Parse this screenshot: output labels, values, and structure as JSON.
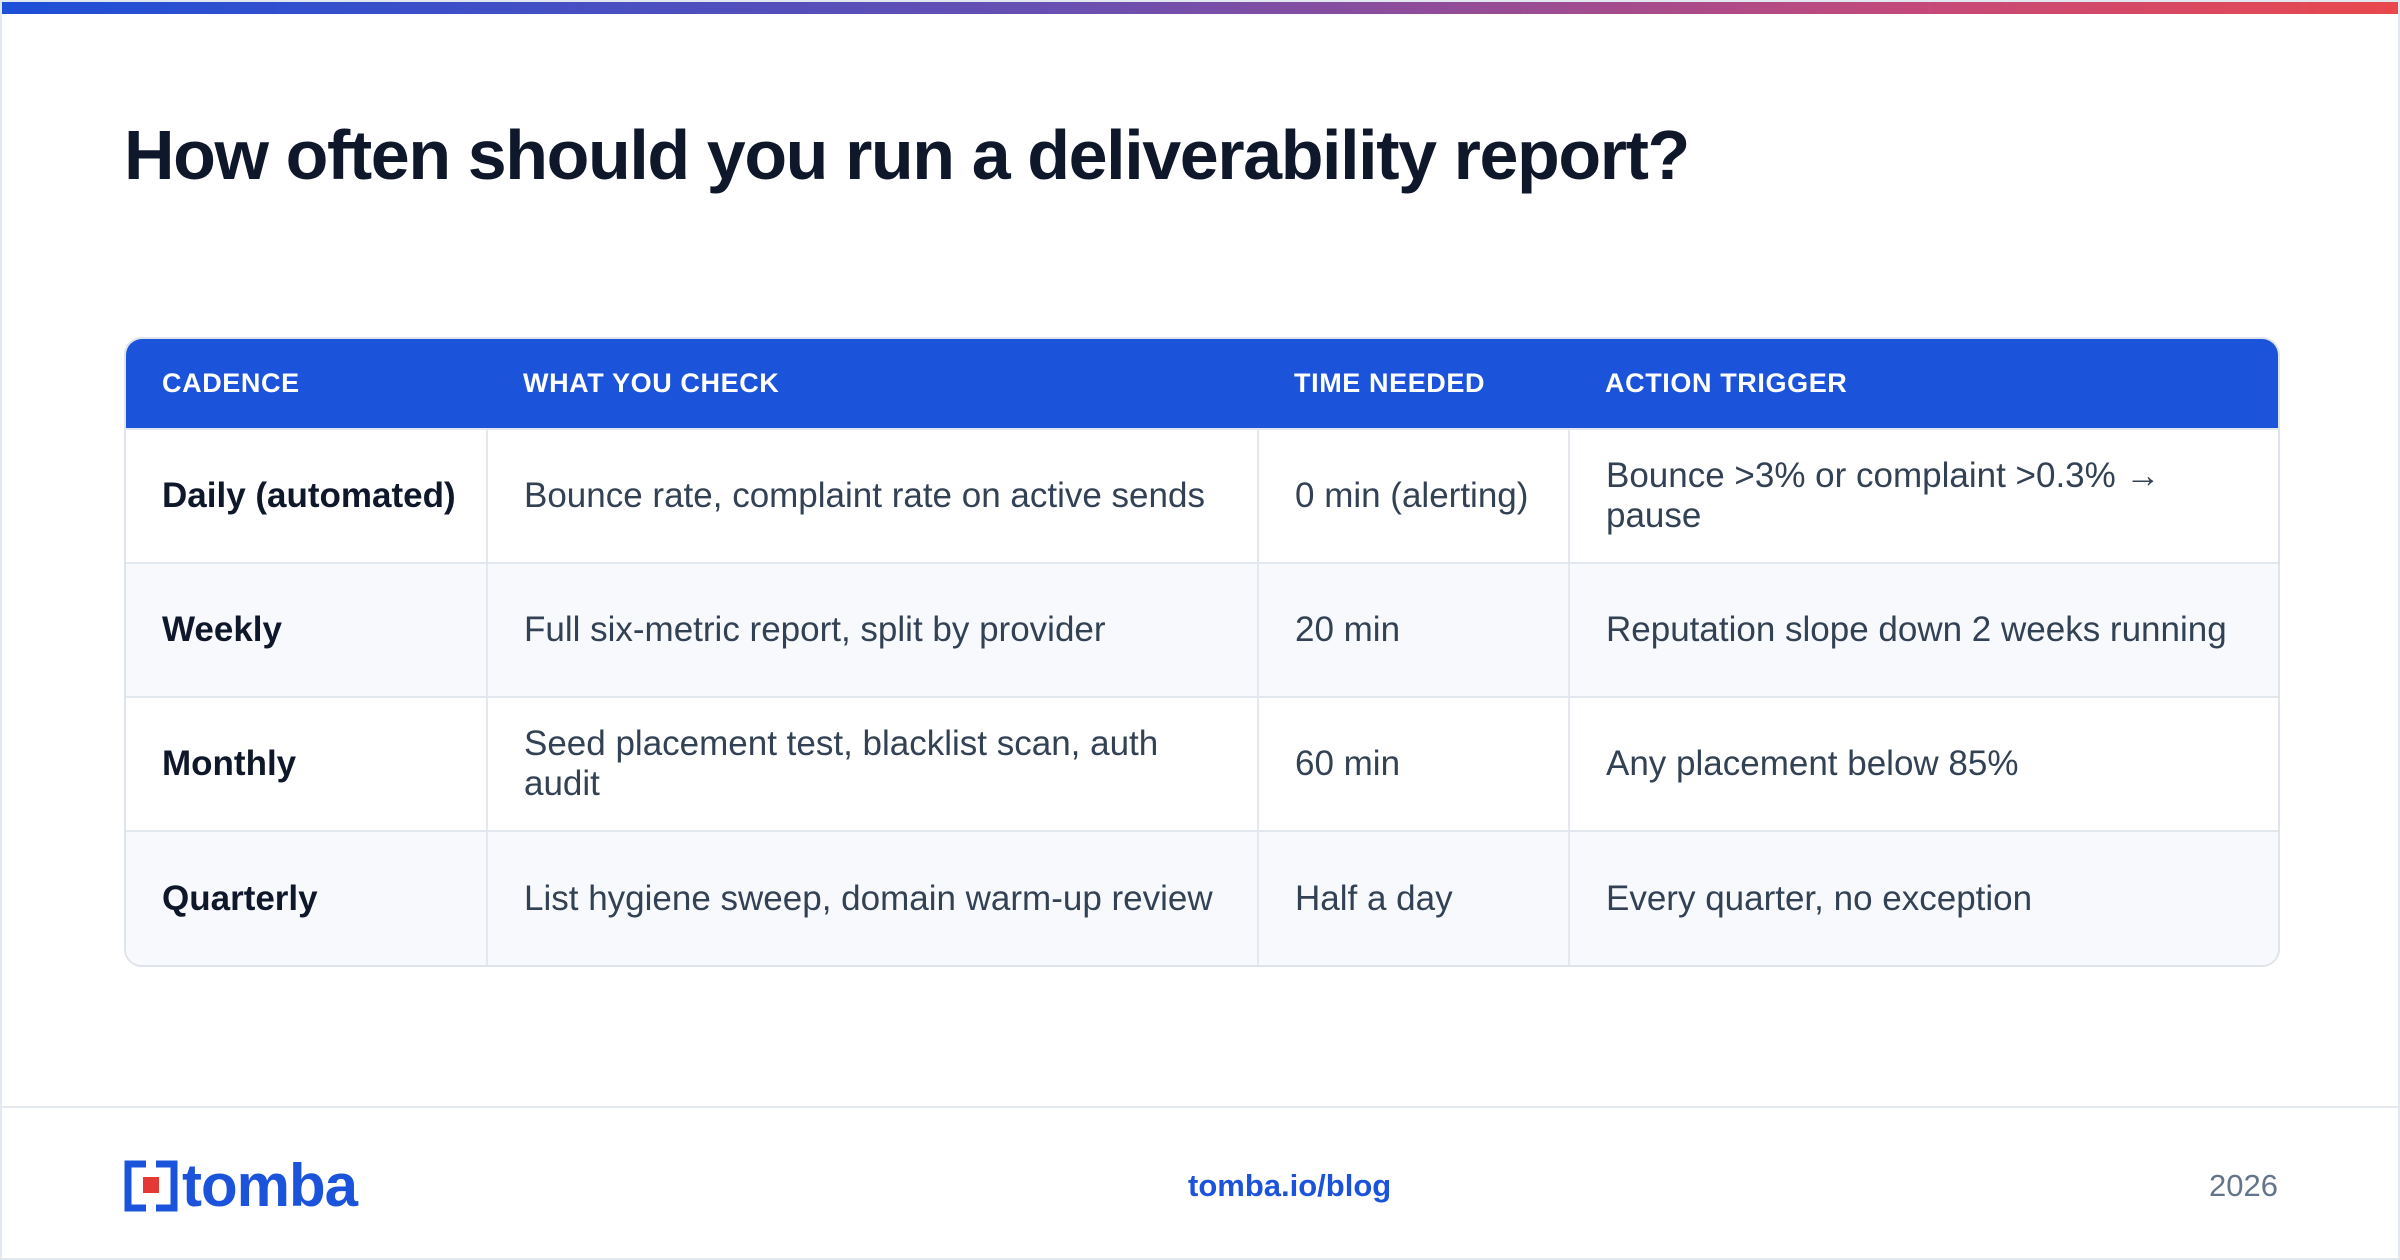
{
  "title": "How often should you run a deliverability report?",
  "table": {
    "headers": [
      "CADENCE",
      "WHAT YOU CHECK",
      "TIME NEEDED",
      "ACTION TRIGGER"
    ],
    "rows": [
      [
        "Daily (automated)",
        "Bounce rate, complaint rate on active sends",
        "0 min (alerting)",
        "Bounce >3% or complaint >0.3% → pause"
      ],
      [
        "Weekly",
        "Full six-metric report, split by provider",
        "20 min",
        "Reputation slope down 2 weeks running"
      ],
      [
        "Monthly",
        "Seed placement test, blacklist scan, auth audit",
        "60 min",
        "Any placement below 85%"
      ],
      [
        "Quarterly",
        "List hygiene sweep, domain warm-up review",
        "Half a day",
        "Every quarter, no exception"
      ]
    ]
  },
  "footer": {
    "logo_text": "tomba",
    "link": "tomba.io/blog",
    "year": "2026"
  },
  "colors": {
    "accent": "#1c53db",
    "logo_red": "#e53935",
    "title": "#0f172a",
    "muted": "#64748b"
  },
  "icons": {
    "logo": "tomba-logo-icon"
  }
}
